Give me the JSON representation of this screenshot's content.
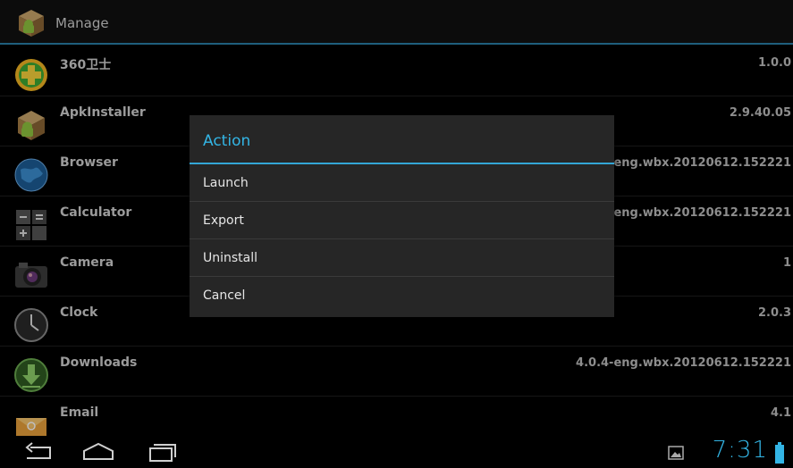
{
  "actionbar": {
    "title": "Manage",
    "icon": "android-package-icon"
  },
  "apps": [
    {
      "name": "360卫士",
      "version": "1.0.0",
      "icon": "plus-shield-icon"
    },
    {
      "name": "ApkInstaller",
      "version": "2.9.40.05",
      "icon": "android-package-icon"
    },
    {
      "name": "Browser",
      "version": "4.0.4-eng.wbx.20120612.152221",
      "icon": "globe-icon"
    },
    {
      "name": "Calculator",
      "version": "4.0.4-eng.wbx.20120612.152221",
      "icon": "calculator-icon"
    },
    {
      "name": "Camera",
      "version": "1",
      "icon": "camera-icon"
    },
    {
      "name": "Clock",
      "version": "2.0.3",
      "icon": "clock-icon"
    },
    {
      "name": "Downloads",
      "version": "4.0.4-eng.wbx.20120612.152221",
      "icon": "download-icon"
    },
    {
      "name": "Email",
      "version": "4.1",
      "icon": "email-icon"
    }
  ],
  "dialog": {
    "title": "Action",
    "items": [
      "Launch",
      "Export",
      "Uninstall",
      "Cancel"
    ]
  },
  "statusbar": {
    "time": "7:31"
  },
  "colors": {
    "accent": "#33b5e5",
    "dialog_bg": "#262626"
  }
}
